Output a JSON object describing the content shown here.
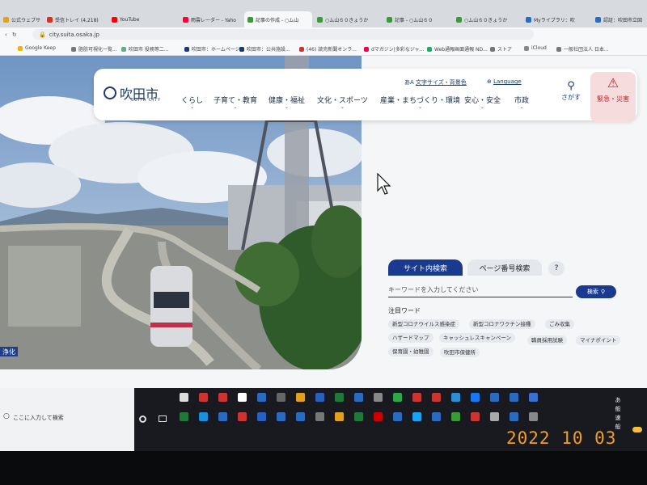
{
  "browser": {
    "tabs": [
      {
        "title": "公式ウェブサ",
        "color": "#e0a020"
      },
      {
        "title": "受信トレイ (4,218)",
        "color": "#d93025"
      },
      {
        "title": "YouTube",
        "color": "#ff0000"
      },
      {
        "title": "雨雲レーダー - Yaho",
        "color": "#ff0033"
      },
      {
        "title": "記事の作成 - ○ム山",
        "color": "#3a9a3a"
      },
      {
        "title": "○ム山６０きょうか",
        "color": "#3a9a3a"
      },
      {
        "title": "記事 - ○ム山６０",
        "color": "#3a9a3a"
      },
      {
        "title": "○ム山６０きょうか",
        "color": "#3a9a3a"
      },
      {
        "title": "Myライブラリ：吹",
        "color": "#2a6ac0"
      },
      {
        "title": "認証：吹田市立図",
        "color": "#2a6ac0"
      }
    ],
    "url": "city.suita.osaka.jp",
    "bookmarks": [
      "Google Keep",
      "脂肪可視化一覧...",
      "吹田市 役務等二...",
      "吹田市：ホームページ",
      "吹田市：公共施設...",
      "(46) 読売新聞オンラ...",
      "dマガジン|多彩なジャ...",
      "Web通報画面通報 ND...",
      "ストア",
      "iCloud",
      "一般社団法人 日本..."
    ]
  },
  "header": {
    "logo_text": "吹田市",
    "logo_sub": "SUITA CITY",
    "text_size_label": "文字サイズ・背景色",
    "language_label": "Language",
    "nav": [
      "くらし",
      "子育て・教育",
      "健康・福祉",
      "文化・スポーツ",
      "産業・まちづくり・環境",
      "安心・安全",
      "市政"
    ],
    "search_label": "さがす",
    "emergency_label": "緊急・災害"
  },
  "search": {
    "tab_site": "サイト内検索",
    "tab_page": "ページ番号検索",
    "help": "?",
    "placeholder": "キーワードを入力してください",
    "button": "検索",
    "hot_label": "注目ワード",
    "keywords": [
      "新型コロナウイルス感染症",
      "新型コロナワクチン接種",
      "ごみ収集",
      "ハザードマップ",
      "キャッシュレスキャンペーン",
      "職員採用試験",
      "マイナポイント",
      "保育園・幼稚園",
      "吹田市保健所"
    ]
  },
  "hero_sign": "浄化",
  "taskbar": {
    "search_placeholder": "ここに入力して検索",
    "tray": [
      "あ",
      "般",
      "速",
      "般"
    ]
  },
  "photo_date": "2022 10 03"
}
